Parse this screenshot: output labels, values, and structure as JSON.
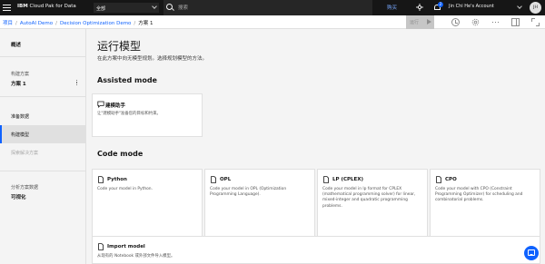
{
  "header": {
    "brand_prefix": "IBM",
    "brand_name": "Cloud Pak for Data",
    "scope_label": "全部",
    "search_placeholder": "搜索",
    "buy_label": "购买",
    "notification_count": "2",
    "account_name": "Jin Chi He's Account",
    "avatar_initials": "JH"
  },
  "breadcrumb": {
    "projects": "项目",
    "project": "AutoAI Demo",
    "model": "Decision Optimization Demo",
    "current": "方案 1"
  },
  "toolbar": {
    "run_label": "运行"
  },
  "sidebar": {
    "overview": "概述",
    "scenario_section": "构建方案",
    "scenario_name": "方案 1",
    "prepare_data": "准备数据",
    "build_model": "构建模型",
    "explore_solution": "探索解决方案",
    "analysis_section": "分析方案数据",
    "visualization": "可视化"
  },
  "main": {
    "title": "运行模型",
    "subtitle": "在此方案中向无模型规划。选择规划模型的方法。",
    "assisted_heading": "Assisted mode",
    "assistant": {
      "title": "建模助手",
      "desc": "让\"建模助手\"准备您的目标和约束。"
    },
    "code_heading": "Code mode",
    "code_tiles": [
      {
        "title": "Python",
        "desc": "Code your model in Python."
      },
      {
        "title": "OPL",
        "desc": "Code your model in OPL (Optimization Programming Language)."
      },
      {
        "title": "LP (CPLEX)",
        "desc": "Code your model in lp format for CPLEX (mathematical programming solver) for linear, mixed-integer and quadratic programming problems."
      },
      {
        "title": "CPO",
        "desc": "Code your model with CPO (Constraint Programming Optimizer) for scheduling and combinatorial problems."
      }
    ],
    "import": {
      "title": "Import model",
      "desc": "从现有的 Notebook 或外部文件导入模型。"
    }
  },
  "colors": {
    "accent": "#0f62fe",
    "header_bg": "#161616",
    "page_bg": "#f4f4f4"
  }
}
